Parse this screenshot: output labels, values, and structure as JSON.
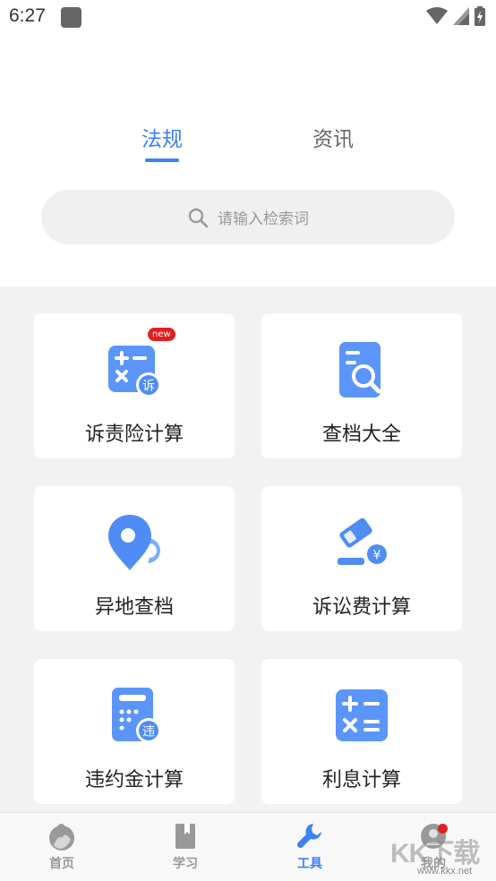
{
  "status_bar": {
    "time": "6:27"
  },
  "tabs": [
    {
      "label": "法规",
      "active": true
    },
    {
      "label": "资讯",
      "active": false
    }
  ],
  "search": {
    "placeholder": "请输入检索词",
    "icon": "search-icon"
  },
  "tools": [
    {
      "label": "诉责险计算",
      "icon": "calculator-badge-icon",
      "badge": "new",
      "icon_badge_text": "诉"
    },
    {
      "label": "查档大全",
      "icon": "document-search-icon"
    },
    {
      "label": "异地查档",
      "icon": "location-pin-icon"
    },
    {
      "label": "诉讼费计算",
      "icon": "gavel-yen-icon",
      "icon_badge_text": "¥"
    },
    {
      "label": "违约金计算",
      "icon": "calculator-badge-icon",
      "icon_badge_text": "违"
    },
    {
      "label": "利息计算",
      "icon": "calculator-icon"
    }
  ],
  "bottom_nav": [
    {
      "label": "首页",
      "icon": "home-icon",
      "active": false
    },
    {
      "label": "学习",
      "icon": "book-icon",
      "active": false
    },
    {
      "label": "工具",
      "icon": "wrench-icon",
      "active": true
    },
    {
      "label": "我的",
      "icon": "profile-icon",
      "active": false,
      "notification_dot": true
    }
  ],
  "watermark": {
    "text": "KK下载",
    "url": "www.kkx.net"
  },
  "colors": {
    "accent": "#3b82f6",
    "badge": "#e02020",
    "icon_blue": "#4f8df5"
  }
}
